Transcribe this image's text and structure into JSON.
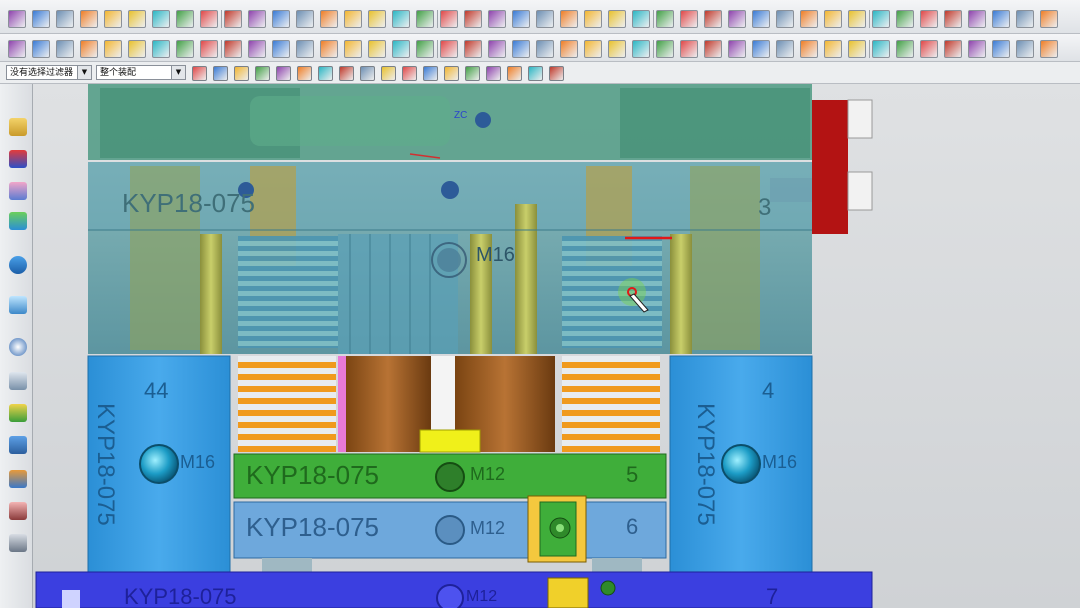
{
  "toolbar": {
    "filter_select": "没有选择过滤器",
    "assembly_select": "整个装配"
  },
  "model": {
    "label_text": "KYP18-075",
    "top_plate_number": "3",
    "left_block_number": "44",
    "right_block_number": "4",
    "green_plate_number": "5",
    "blue_plate_number": "6",
    "bottom_plate_number": "7",
    "bolt_m16": "M16",
    "bolt_m12": "M12",
    "axis_label": "ZC"
  },
  "colors": {
    "top_plate": "#5f9fa6",
    "side_block": "#3aa0e0",
    "green_plate": "#3fae3a",
    "blue_plate": "#6ea8dc",
    "bottom_plate": "#3b3fe0",
    "red_block": "#b31313",
    "spring_orange": "#f09a1d"
  }
}
